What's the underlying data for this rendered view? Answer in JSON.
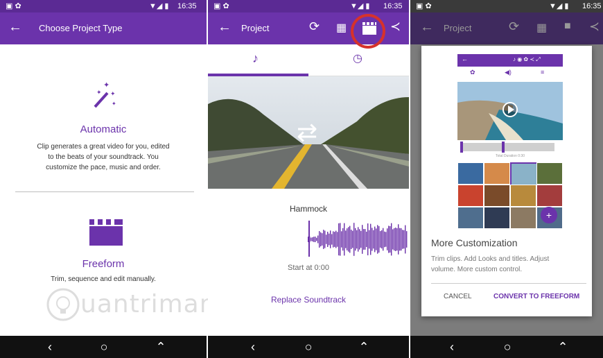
{
  "colors": {
    "purple": "#6b33ab",
    "purple_dark": "#5b2a94",
    "accent": "#7a2cc0",
    "red_circle": "#d6322b"
  },
  "status": {
    "time": "16:35"
  },
  "screen1": {
    "title": "Choose Project Type",
    "automatic": {
      "title": "Automatic",
      "desc_lines": [
        "Clip generates a great video for you, edited",
        "to the beats of your soundtrack. You",
        "customize the pace, music and order."
      ]
    },
    "freeform": {
      "title": "Freeform",
      "desc": "Trim, sequence and edit manually."
    },
    "watermark": "uantrimang"
  },
  "screen2": {
    "title": "Project",
    "tabs": [
      {
        "icon": "music-note-icon",
        "selected": true
      },
      {
        "icon": "clock-icon",
        "selected": false
      }
    ],
    "track": {
      "name": "Hammock",
      "start": "Start at 0:00"
    },
    "replace": "Replace Soundtrack"
  },
  "screen3": {
    "title": "Project",
    "dialog": {
      "tutorial_caption": "Total Duration 0:30",
      "heading": "More Customization",
      "body_lines": [
        "Trim clips. Add Looks and titles. Adjust",
        "volume. More custom control."
      ],
      "cancel": "CANCEL",
      "convert": "CONVERT TO FREEFORM"
    }
  },
  "nav": {
    "back": "‹",
    "home": "○",
    "recents": "⌃"
  }
}
